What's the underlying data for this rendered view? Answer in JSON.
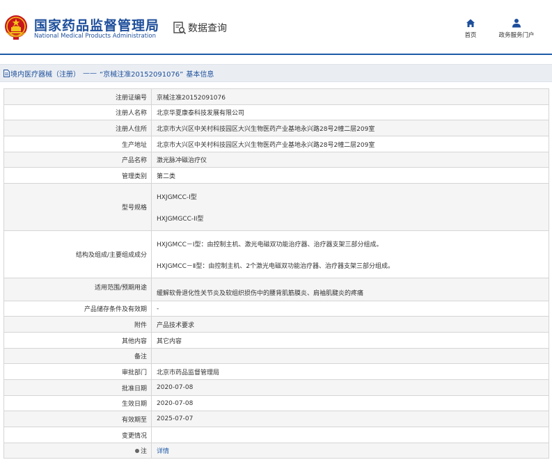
{
  "header": {
    "title_cn": "国家药品监督管理局",
    "title_en": "National Medical Products Administration",
    "data_query": "数据查询",
    "nav": [
      {
        "label": "首页",
        "icon": "home-icon"
      },
      {
        "label": "政务服务门户",
        "icon": "user-icon"
      }
    ]
  },
  "breadcrumb": {
    "category": "境内医疗器械（注册）",
    "separator": "——",
    "record": "“京械注准20152091076”",
    "suffix": "基本信息"
  },
  "colors": {
    "brand": "#1d4e9b",
    "emblem_red": "#c8161d",
    "emblem_gold": "#f3c21a",
    "link": "#1d5aa6"
  },
  "rows": [
    {
      "label": "注册证编号",
      "value": "京械注准20152091076"
    },
    {
      "label": "注册人名称",
      "value": "北京华夏康泰科技发展有限公司"
    },
    {
      "label": "注册人住所",
      "value": "北京市大兴区中关村科技园区大兴生物医药产业基地永兴路28号2幢二层209室"
    },
    {
      "label": "生产地址",
      "value": "北京市大兴区中关村科技园区大兴生物医药产业基地永兴路28号2幢二层209室"
    },
    {
      "label": "产品名称",
      "value": "激光脉冲磁治疗仪"
    },
    {
      "label": "管理类别",
      "value": "第二类"
    },
    {
      "label": "型号规格",
      "value_1": "HXJGMCC-Ⅰ型",
      "value_2": "HXJGMGCC-II型"
    },
    {
      "label": "结构及组成/主要组成成分",
      "value_1": "HXJGMCC－Ⅰ型：由控制主机、激光电磁双功能治疗器、治疗器支架三部分组成。",
      "value_2": "HXJGMCC－Ⅱ型：由控制主机、2个激光电磁双功能治疗器、治疗器支架三部分组成。"
    },
    {
      "label": "适用范围/预期用途",
      "value": "缓解软骨退化性关节炎及软组织损伤中的腰背肌筋膜炎、肩袖肌腱炎的疼痛"
    },
    {
      "label": "产品储存条件及有效期",
      "value": "-"
    },
    {
      "label": "附件",
      "value": "产品技术要求"
    },
    {
      "label": "其他内容",
      "value": "其它内容"
    },
    {
      "label": "备注",
      "value": ""
    },
    {
      "label": "审批部门",
      "value": "北京市药品监督管理局"
    },
    {
      "label": "批准日期",
      "value": "2020-07-08"
    },
    {
      "label": "生效日期",
      "value": "2020-07-08"
    },
    {
      "label": "有效期至",
      "value": "2025-07-07"
    },
    {
      "label": "变更情况",
      "value": ""
    },
    {
      "label": "注",
      "value": "详情",
      "icon": "pin-icon"
    }
  ]
}
